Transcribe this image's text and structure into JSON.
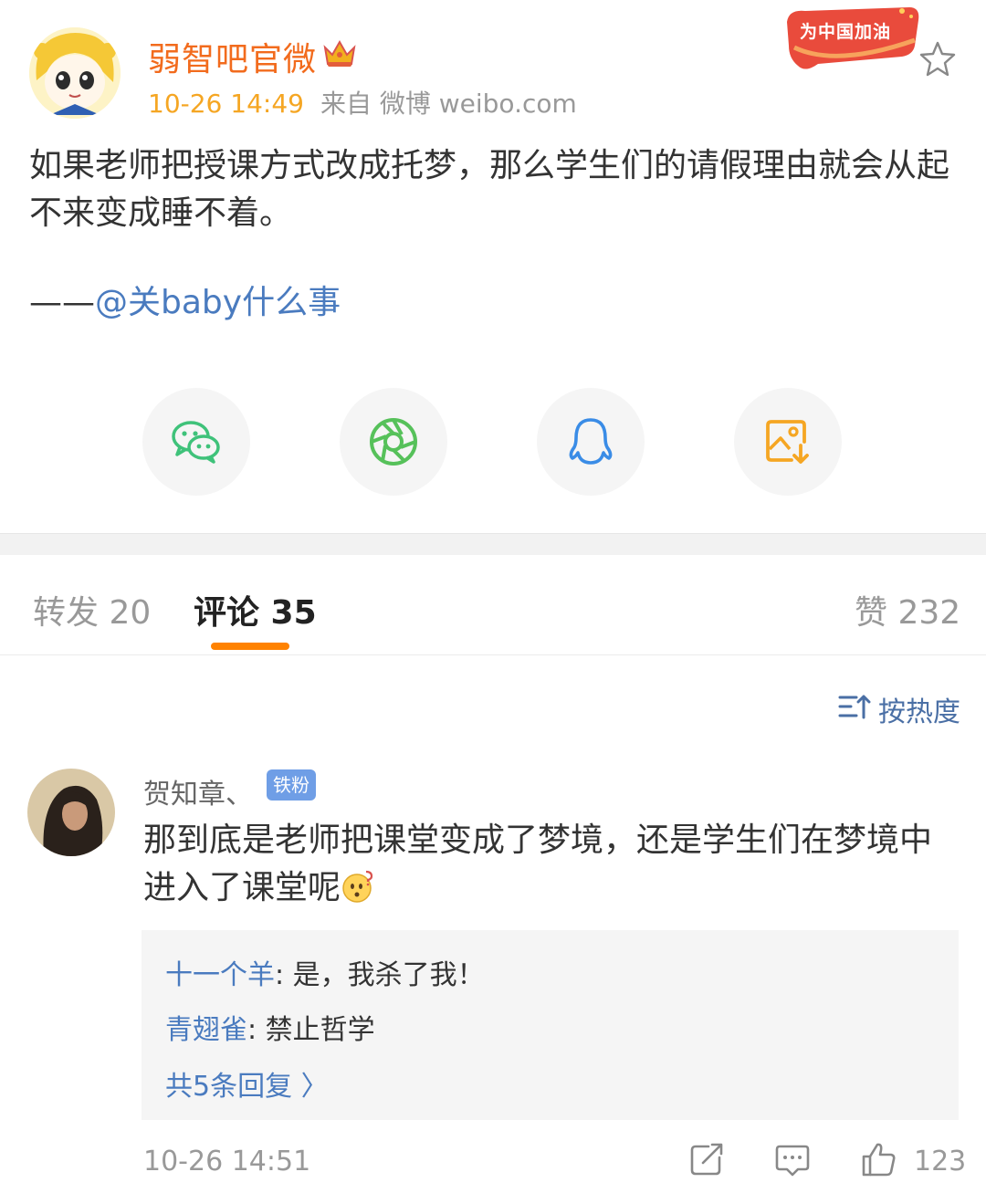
{
  "post": {
    "author": "弱智吧官微",
    "time": "10-26 14:49",
    "source": "来自 微博 weibo.com",
    "promo_badge": "为中国加油",
    "body": "如果老师把授课方式改成托梦，那么学生们的请假理由就会从起不来变成睡不着。",
    "credit_prefix": "——",
    "credit_mention": "@关baby什么事"
  },
  "share": {
    "items": [
      "wechat-icon",
      "moments-icon",
      "qq-icon",
      "save-image-icon"
    ],
    "colors": {
      "wechat": "#3fc27a",
      "moments": "#56c15a",
      "qq": "#3a8ce6",
      "save": "#f5a623"
    }
  },
  "tabs": {
    "repost": "转发 20",
    "comments": "评论 35",
    "likes": "赞 232"
  },
  "sort_label": "按热度",
  "comment": {
    "user": "贺知章、",
    "badge": "铁粉",
    "text": "那到底是老师把课堂变成了梦境，还是学生们在梦境中进入了课堂呢",
    "replies": [
      {
        "user": "十一个羊",
        "text": ": 是，我杀了我！"
      },
      {
        "user": "青翅雀",
        "text": ": 禁止哲学"
      }
    ],
    "more_replies": "共5条回复 〉",
    "time": "10-26 14:51",
    "like_count": "123"
  },
  "colors": {
    "author": "#f26b1d",
    "accent": "#ff8200",
    "link": "#4a7bbf"
  }
}
